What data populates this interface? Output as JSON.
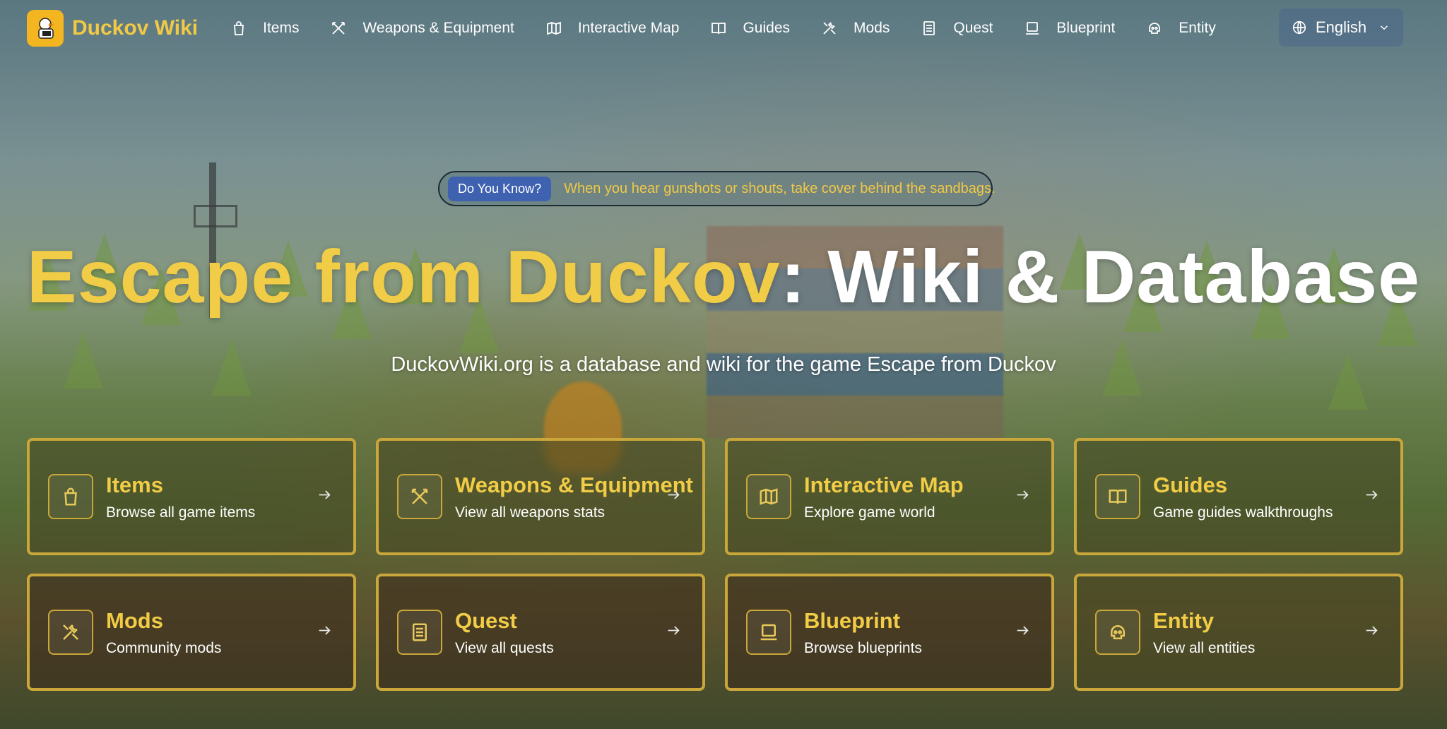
{
  "brand": {
    "name": "Duckov Wiki",
    "logo_icon": "duck-logo-icon"
  },
  "nav": {
    "items": [
      {
        "label": "Items",
        "icon": "shopping-bag-icon"
      },
      {
        "label": "Weapons & Equipment",
        "icon": "crossed-swords-icon"
      },
      {
        "label": "Interactive Map",
        "icon": "map-icon"
      },
      {
        "label": "Guides",
        "icon": "book-open-icon"
      },
      {
        "label": "Mods",
        "icon": "tools-icon"
      },
      {
        "label": "Quest",
        "icon": "document-list-icon"
      },
      {
        "label": "Blueprint",
        "icon": "laptop-icon"
      },
      {
        "label": "Entity",
        "icon": "skull-icon"
      }
    ]
  },
  "language": {
    "label": "English",
    "icon": "globe-icon"
  },
  "tip": {
    "badge": "Do You Know?",
    "text": "When you hear gunshots or shouts, take cover behind the sandbags."
  },
  "hero": {
    "title_accent": "Escape from Duckov",
    "title_rest": ": Wiki & Database",
    "subtitle": "DuckovWiki.org is a database and wiki for the game Escape from Duckov"
  },
  "cards": [
    {
      "title": "Items",
      "description": "Browse all game items",
      "icon": "shopping-bag-icon"
    },
    {
      "title": "Weapons & Equipment",
      "description": "View all weapons stats",
      "icon": "crossed-swords-icon"
    },
    {
      "title": "Interactive Map",
      "description": "Explore game world",
      "icon": "map-icon"
    },
    {
      "title": "Guides",
      "description": "Game guides walkthroughs",
      "icon": "book-open-icon"
    },
    {
      "title": "Mods",
      "description": "Community mods",
      "icon": "tools-icon"
    },
    {
      "title": "Quest",
      "description": "View all quests",
      "icon": "document-list-icon"
    },
    {
      "title": "Blueprint",
      "description": "Browse blueprints",
      "icon": "laptop-icon"
    },
    {
      "title": "Entity",
      "description": "View all entities",
      "icon": "skull-icon"
    }
  ],
  "colors": {
    "accent_yellow": "#f1cc46",
    "card_border": "#c9a73a",
    "badge_blue": "#3f62b0",
    "logo_bg": "#f3b520"
  }
}
